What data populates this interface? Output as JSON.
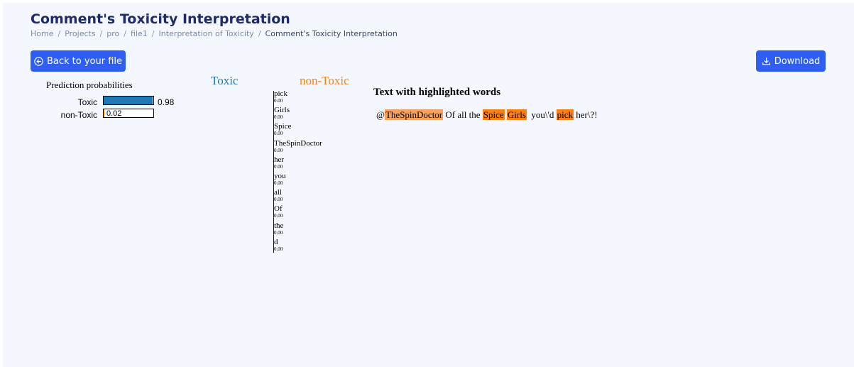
{
  "page": {
    "title": "Comment's Toxicity Interpretation"
  },
  "breadcrumb": [
    {
      "label": "Home",
      "name": "breadcrumb-home"
    },
    {
      "label": "Projects",
      "name": "breadcrumb-projects"
    },
    {
      "label": "pro",
      "name": "breadcrumb-pro"
    },
    {
      "label": "file1",
      "name": "breadcrumb-file1"
    },
    {
      "label": "Interpretation of Toxicity",
      "name": "breadcrumb-interpretation"
    },
    {
      "label": "Comment's Toxicity Interpretation",
      "name": "breadcrumb-current"
    }
  ],
  "buttons": {
    "back_label": "Back to your file",
    "download_label": "Download",
    "back_icon": "arrow-left-circle-icon",
    "download_icon": "download-icon"
  },
  "prediction": {
    "title": "Prediction probabilities",
    "items": [
      {
        "label": "Toxic",
        "value": 0.98,
        "value_text": "0.98",
        "color": "#1f77b4"
      },
      {
        "label": "non-Toxic",
        "value": 0.02,
        "value_text": "0.02",
        "color": "#ff7f0e"
      }
    ]
  },
  "classes": {
    "toxic": "Toxic",
    "non_toxic": "non-Toxic"
  },
  "features": [
    {
      "word": "pick",
      "weight": "0.00"
    },
    {
      "word": "Girls",
      "weight": "0.00"
    },
    {
      "word": "Spice",
      "weight": "0.00"
    },
    {
      "word": "TheSpinDoctor",
      "weight": "0.00"
    },
    {
      "word": "her",
      "weight": "0.00"
    },
    {
      "word": "you",
      "weight": "0.00"
    },
    {
      "word": "all",
      "weight": "0.00"
    },
    {
      "word": "Of",
      "weight": "0.00"
    },
    {
      "word": "the",
      "weight": "0.00"
    },
    {
      "word": "d",
      "weight": "0.00"
    }
  ],
  "highlighted": {
    "title": "Text with highlighted words",
    "segments": [
      {
        "text": "@",
        "highlight": null
      },
      {
        "text": "TheSpinDoctor",
        "highlight": "#f9a15f"
      },
      {
        "text": " Of all the ",
        "highlight": null
      },
      {
        "text": "Spice",
        "highlight": "#ff7f0e"
      },
      {
        "text": " ",
        "highlight": null
      },
      {
        "text": "Girls",
        "highlight": "#ff7f0e"
      },
      {
        "text": "  you\\'d ",
        "highlight": null
      },
      {
        "text": "pick",
        "highlight": "#ff7f0e"
      },
      {
        "text": " her\\?!",
        "highlight": null
      }
    ]
  },
  "colors": {
    "accent": "#2f5ef2",
    "title": "#1f2a6b",
    "toxic": "#1f77b4",
    "non_toxic": "#ff7f0e",
    "background": "#f4f7fe"
  }
}
